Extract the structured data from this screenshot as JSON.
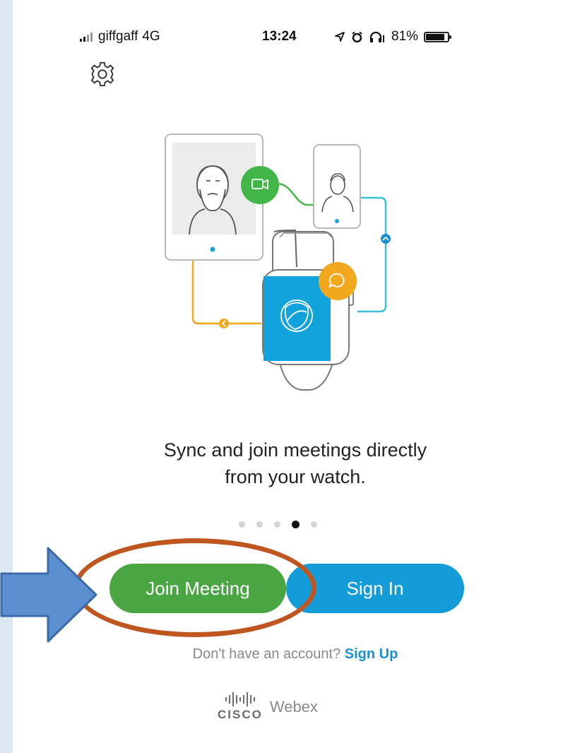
{
  "status_bar": {
    "carrier": "giffgaff",
    "network": "4G",
    "time": "13:24",
    "battery": "81%",
    "icons": [
      "signal-icon",
      "location-icon",
      "alarm-icon",
      "headphones-icon",
      "battery-icon"
    ]
  },
  "settings": {
    "icon": "gear-icon"
  },
  "onboarding": {
    "caption_line1": "Sync and join meetings directly",
    "caption_line2": "from your watch.",
    "page_count": 5,
    "active_page": 4
  },
  "actions": {
    "join_label": "Join Meeting",
    "signin_label": "Sign In"
  },
  "signup": {
    "prompt": "Don't have an account?",
    "link": "Sign Up"
  },
  "brand": {
    "cisco": "CISCO",
    "product": "Webex"
  },
  "colors": {
    "join_green": "#4aa642",
    "signin_blue": "#139cd8",
    "link_blue": "#1b8fd4",
    "highlight_orange": "#c0561f",
    "arrow_blue": "#5b8fd0",
    "video_green": "#43b649",
    "chat_yellow": "#f2a81d",
    "watch_blue": "#12a3dc"
  }
}
